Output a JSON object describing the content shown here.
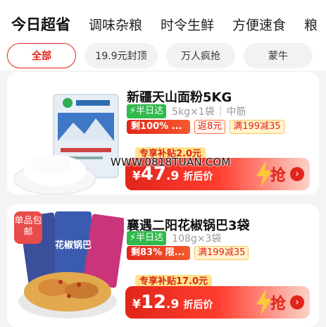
{
  "category_tabs": [
    "今日超省",
    "调味杂粮",
    "时令生鲜",
    "方便速食",
    "粮"
  ],
  "filters": [
    "全部",
    "19.9元封顶",
    "万人疯抢",
    "蒙牛"
  ],
  "products": [
    {
      "title": "新疆天山面粉5KG",
      "speed_tag": "半日达",
      "spec": "5kg×1袋",
      "attr": "中筋",
      "stock": "剩100% ...",
      "rebate": "返8元",
      "full_reduce": "满199减35",
      "subsidy": "专享补贴2.0元",
      "price_currency": "¥",
      "price_int": "47",
      "price_dec": ".9",
      "price_note": "折后价",
      "buy_label": "抢"
    },
    {
      "title": "襄遇二阳花椒锅巴3袋",
      "speed_tag": "半日达",
      "spec": "108g×3袋",
      "stock": "剩83% 限...",
      "full_reduce": "满199减35",
      "subsidy": "专享补贴17.0元",
      "price_currency": "¥",
      "price_int": "12",
      "price_dec": ".9",
      "price_note": "折后价",
      "buy_label": "抢",
      "pack_badge": "单品包邮",
      "package_art_text": "花椒锅巴"
    }
  ],
  "watermark": "WWW.0818TUAN.COM",
  "icons": {
    "speed": "lightning-icon",
    "buy": "lightning-icon",
    "arrow": "chevron-right-icon"
  },
  "colors": {
    "accent": "#e1251b",
    "speed_green": "#2fba4b",
    "subsidy_yellow": "#ffe48a"
  }
}
